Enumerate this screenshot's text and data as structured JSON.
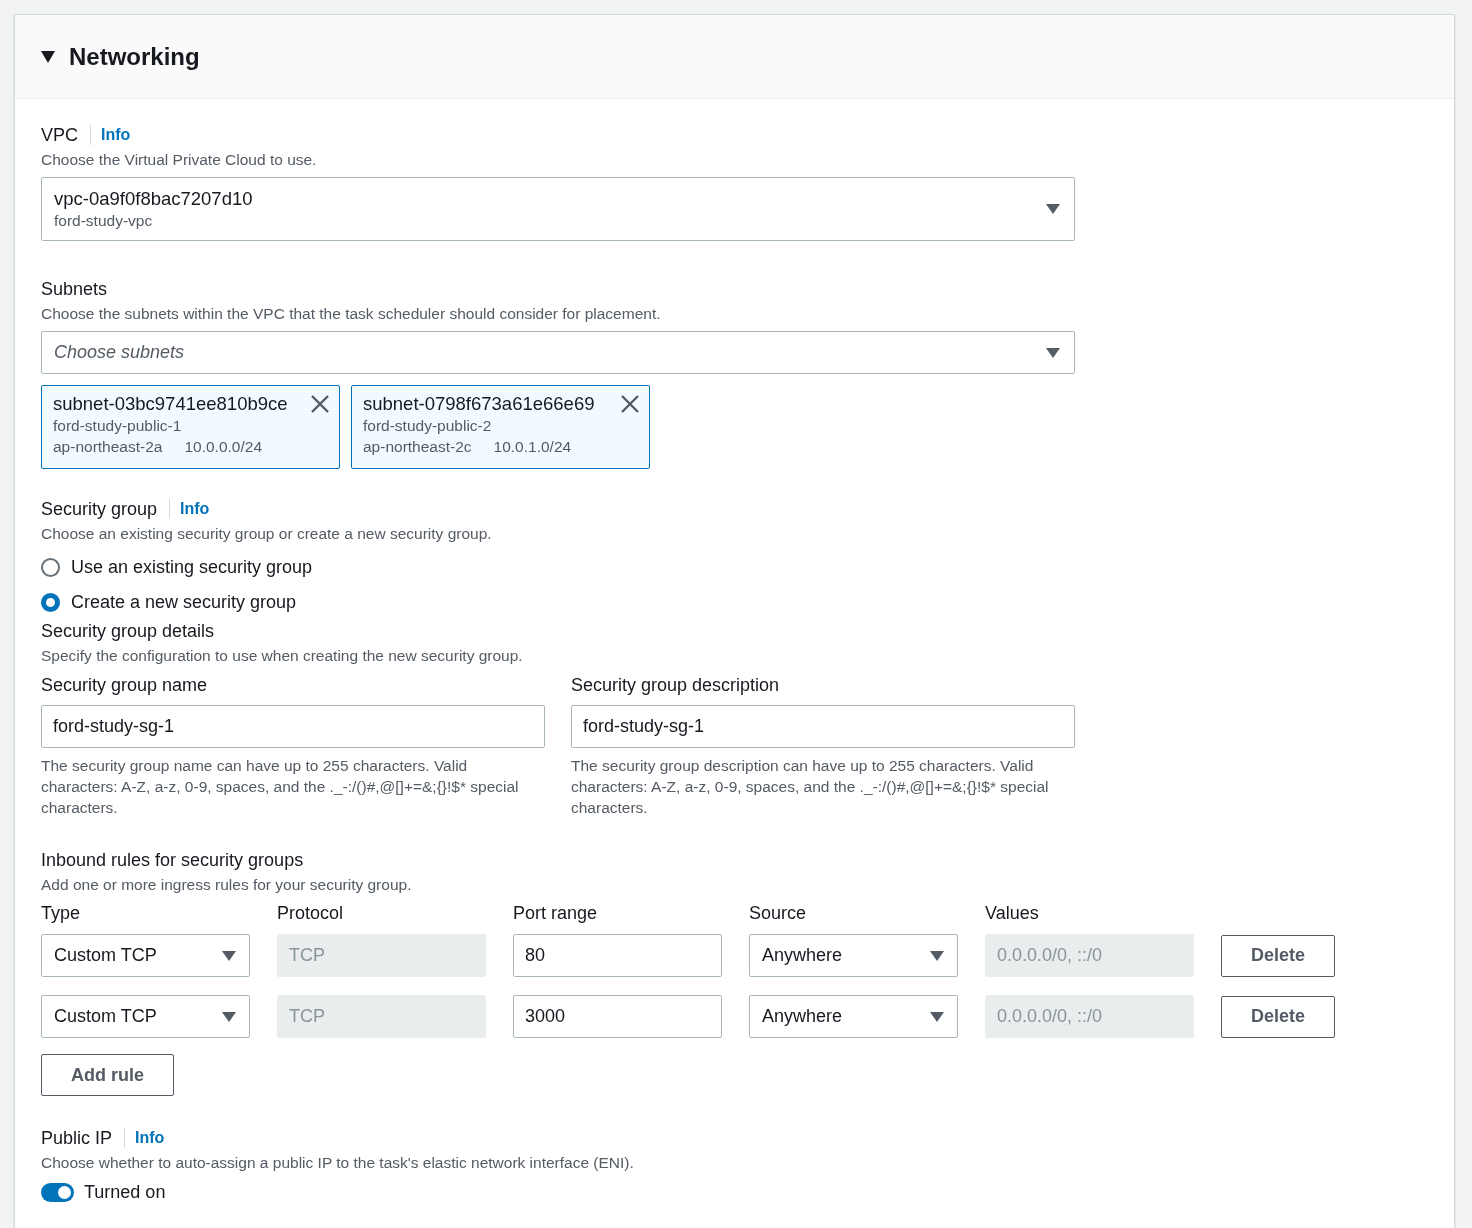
{
  "section": {
    "title": "Networking",
    "expanded": true
  },
  "vpc": {
    "label": "VPC",
    "info": "Info",
    "description": "Choose the Virtual Private Cloud to use.",
    "value": "vpc-0a9f0f8bac7207d10",
    "value_detail": "ford-study-vpc"
  },
  "subnets": {
    "label": "Subnets",
    "description": "Choose the subnets within the VPC that the task scheduler should consider for placement.",
    "placeholder": "Choose subnets",
    "tokens": [
      {
        "id": "subnet-03bc9741ee810b9ce",
        "name": "ford-study-public-1",
        "zone": "ap-northeast-2a",
        "cidr": "10.0.0.0/24"
      },
      {
        "id": "subnet-0798f673a61e66e69",
        "name": "ford-study-public-2",
        "zone": "ap-northeast-2c",
        "cidr": "10.0.1.0/24"
      }
    ]
  },
  "security_group": {
    "label": "Security group",
    "info": "Info",
    "description": "Choose an existing security group or create a new security group.",
    "options": [
      {
        "label": "Use an existing security group",
        "selected": false
      },
      {
        "label": "Create a new security group",
        "selected": true
      }
    ],
    "details": {
      "title": "Security group details",
      "description": "Specify the configuration to use when creating the new security group.",
      "fields": [
        {
          "label": "Security group name",
          "value": "ford-study-sg-1",
          "hint": "The security group name can have up to 255 characters. Valid characters: A-Z, a-z, 0-9, spaces, and the ._-:/()#,@[]+=&;{}!$* special characters."
        },
        {
          "label": "Security group description",
          "value": "ford-study-sg-1",
          "hint": "The security group description can have up to 255 characters. Valid characters: A-Z, a-z, 0-9, spaces, and the ._-:/()#,@[]+=&;{}!$* special characters."
        }
      ]
    }
  },
  "inbound_rules": {
    "title": "Inbound rules for security groups",
    "description": "Add one or more ingress rules for your security group.",
    "columns": [
      "Type",
      "Protocol",
      "Port range",
      "Source",
      "Values"
    ],
    "rows": [
      {
        "type": "Custom TCP",
        "protocol": "TCP",
        "port_range": "80",
        "source": "Anywhere",
        "values": "0.0.0.0/0, ::/0",
        "delete": "Delete"
      },
      {
        "type": "Custom TCP",
        "protocol": "TCP",
        "port_range": "3000",
        "source": "Anywhere",
        "values": "0.0.0.0/0, ::/0",
        "delete": "Delete"
      }
    ],
    "add_button": "Add rule"
  },
  "public_ip": {
    "label": "Public IP",
    "info": "Info",
    "description": "Choose whether to auto-assign a public IP to the task's elastic network interface (ENI).",
    "toggle": {
      "on": true,
      "label": "Turned on"
    }
  }
}
